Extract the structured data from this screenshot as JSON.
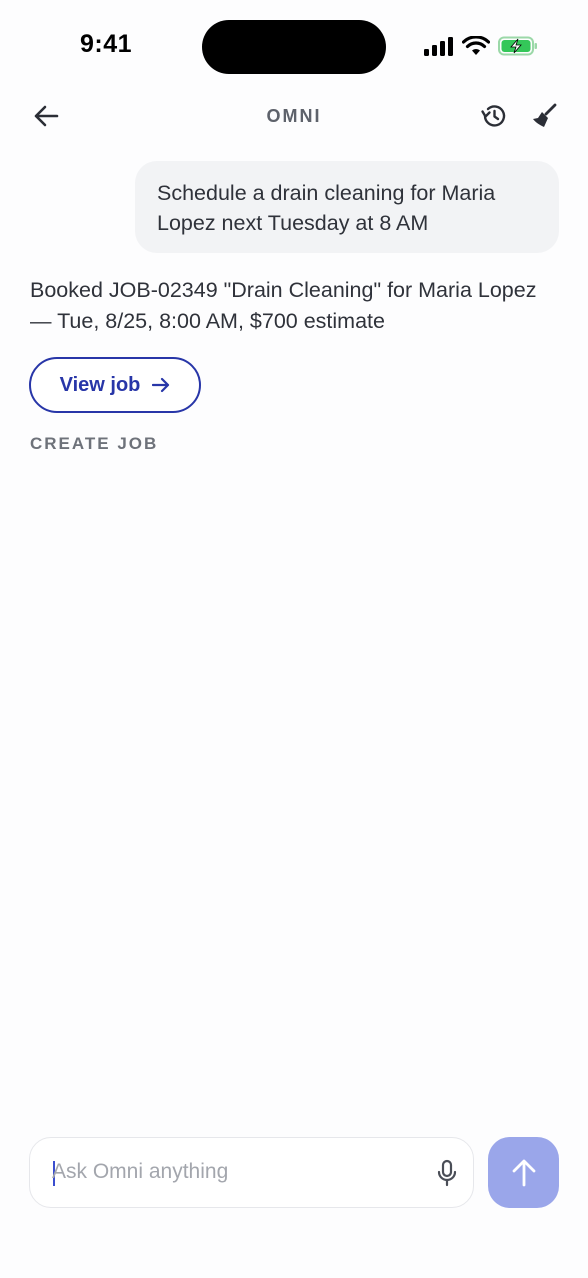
{
  "status_bar": {
    "time": "9:41"
  },
  "header": {
    "title": "OMNI",
    "back_icon": "arrow-left-icon",
    "history_icon": "history-icon",
    "clear_icon": "broom-icon"
  },
  "conversation": {
    "user_message": "Schedule a drain cleaning for Maria Lopez next Tuesday at 8 AM",
    "assistant_message": "Booked JOB-02349 \"Drain Cleaning\" for Maria Lopez — Tue, 8/25, 8:00 AM, $700 estimate",
    "action_button_label": "View job",
    "tool_label": "CREATE JOB"
  },
  "composer": {
    "placeholder": "Ask Omni anything",
    "value": "",
    "mic_icon": "microphone-icon",
    "send_icon": "arrow-up-icon"
  },
  "colors": {
    "accent": "#2836a8",
    "send_button": "#9aa6ea",
    "user_bubble": "#f2f3f5",
    "battery": "#34c759"
  }
}
